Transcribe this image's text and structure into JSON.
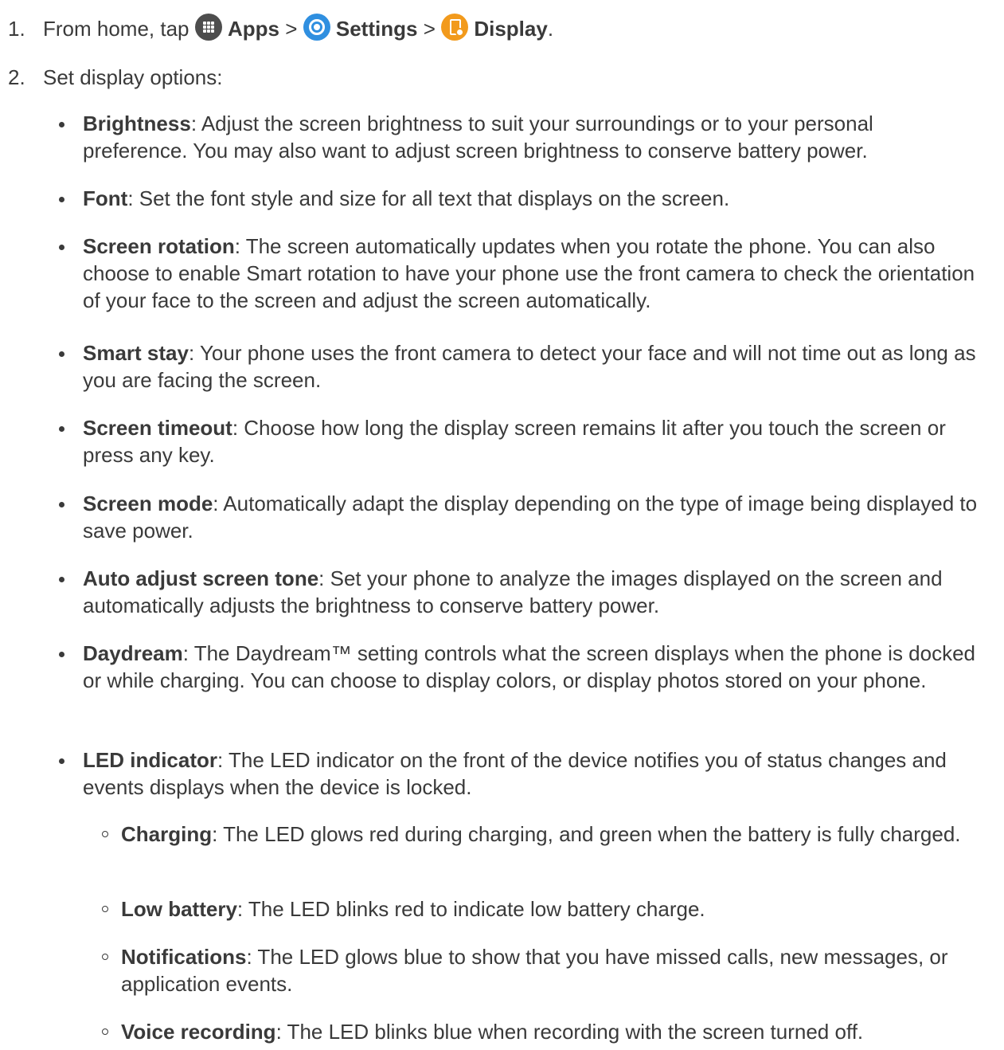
{
  "step1": {
    "num": "1.",
    "prefix": "From home, tap",
    "apps_label": "Apps",
    "sep1": ">",
    "settings_label": "Settings",
    "sep2": ">",
    "display_label": "Display",
    "end": "."
  },
  "step2": {
    "num": "2.",
    "text": "Set display options:"
  },
  "options": [
    {
      "term": "Brightness",
      "desc": ": Adjust the screen brightness to suit your surroundings or to your personal preference. You may also want to adjust screen brightness to conserve battery power."
    },
    {
      "term": "Font",
      "desc": ": Set the font style and size for all text that displays on the screen."
    },
    {
      "term": "Screen rotation",
      "desc": ": The screen automatically updates when you rotate the phone. You can also choose to enable Smart rotation to have your phone use the front camera to check the orientation of your face to the screen and adjust the screen automatically."
    },
    {
      "term": "Smart stay",
      "desc": ": Your phone uses the front camera to detect your face and will not time out as long as you are facing the screen."
    },
    {
      "term": "Screen timeout",
      "desc": ": Choose how long the display screen remains lit after you touch the screen or press any key."
    },
    {
      "term": "Screen mode",
      "desc": ": Automatically adapt the display depending on the type of image being displayed to save power."
    },
    {
      "term": "Auto adjust screen tone",
      "desc": ": Set your phone to analyze the images displayed on the screen and automatically adjusts the brightness to conserve battery power."
    },
    {
      "term": "Daydream",
      "desc": ": The Daydream™ setting controls what the screen displays when the phone is docked or while charging. You can choose to display colors, or display photos stored on your phone."
    },
    {
      "term": "LED indicator",
      "desc": ": The LED indicator on the front of the device notifies you of status changes and events displays when the device is locked."
    }
  ],
  "led_options": [
    {
      "term": "Charging",
      "desc": ": The LED glows red during charging, and green when the battery is fully charged."
    },
    {
      "term": "Low battery",
      "desc": ": The LED blinks red to indicate low battery charge."
    },
    {
      "term": "Notifications",
      "desc": ": The LED glows blue to show that you have missed calls, new messages, or application events."
    },
    {
      "term": "Voice recording",
      "desc": ": The LED blinks blue when recording with the screen turned off."
    }
  ],
  "icons": {
    "apps": "apps-icon",
    "settings": "settings-icon",
    "display": "display-icon"
  }
}
